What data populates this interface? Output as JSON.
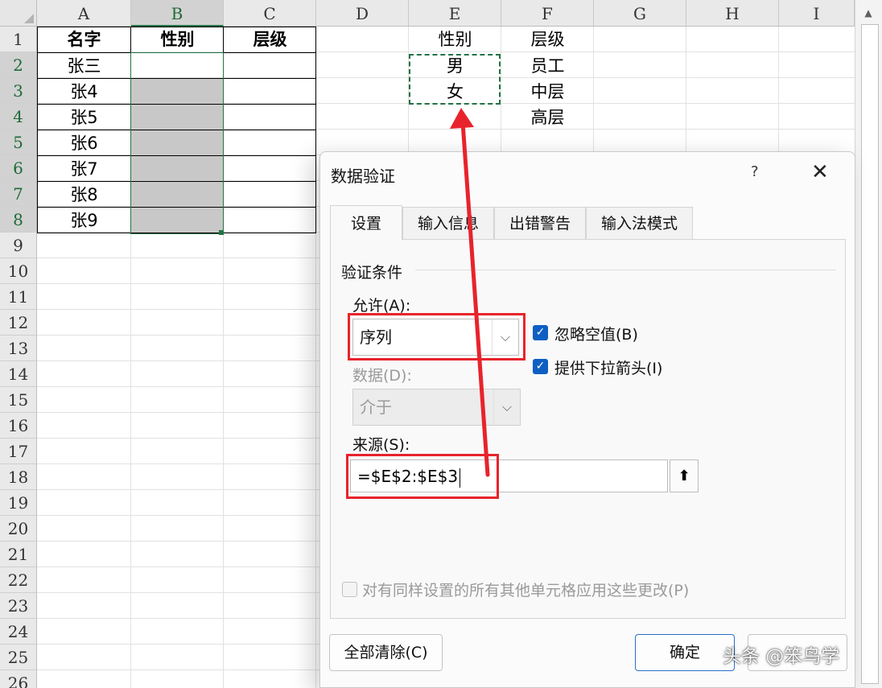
{
  "sheet": {
    "columns": [
      "A",
      "B",
      "C",
      "D",
      "E",
      "F",
      "G",
      "H",
      "I"
    ],
    "rows": [
      "1",
      "2",
      "3",
      "4",
      "5",
      "6",
      "7",
      "8",
      "9",
      "10",
      "11",
      "12",
      "13",
      "14",
      "15",
      "16",
      "17",
      "18",
      "19",
      "20",
      "21",
      "22",
      "23",
      "24",
      "25",
      "26"
    ],
    "table": {
      "headers": [
        "名字",
        "性别",
        "层级"
      ],
      "names": [
        "张三",
        "张4",
        "张5",
        "张6",
        "张7",
        "张8",
        "张9"
      ]
    },
    "lists": {
      "gender_header": "性别",
      "gender_items": [
        "男",
        "女"
      ],
      "level_header": "层级",
      "level_items": [
        "员工",
        "中层",
        "高层"
      ]
    },
    "colors": {
      "selection": "#217346",
      "highlight_fill": "#c8c8c8",
      "annotation": "#e8232b"
    }
  },
  "dialog": {
    "title": "数据验证",
    "help": "?",
    "close": "✕",
    "tabs": [
      "设置",
      "输入信息",
      "出错警告",
      "输入法模式"
    ],
    "active_tab": "设置",
    "group_label": "验证条件",
    "allow_label": "允许(A):",
    "allow_value": "序列",
    "data_label": "数据(D):",
    "data_value": "介于",
    "ignore_blank": {
      "label": "忽略空值(B)",
      "checked": true
    },
    "in_cell_dropdown": {
      "label": "提供下拉箭头(I)",
      "checked": true
    },
    "source_label": "来源(S):",
    "source_value": "=$E$2:$E$3",
    "apply_all": {
      "label": "对有同样设置的所有其他单元格应用这些更改(P)",
      "checked": false
    },
    "clear_all_button": "全部清除(C)",
    "ok_button": "确定"
  },
  "icons": {
    "chevron": "chevron-down-icon",
    "check": "checkmark-icon",
    "collapse": "collapse-dialog-icon"
  },
  "watermark": "头条 @笨鸟学"
}
